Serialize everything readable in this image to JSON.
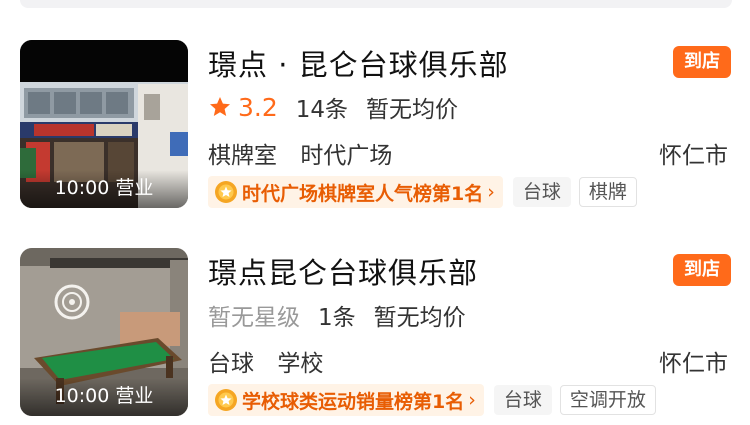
{
  "colors": {
    "accent": "#ff6a1a",
    "rank_bg": "#fff3e6",
    "rank_text": "#e85d04"
  },
  "listings": [
    {
      "title": "璟点 · 昆仑台球俱乐部",
      "store_badge": "到店",
      "hours": "10:00 营业",
      "rating": "3.2",
      "reviews": "14条",
      "price": "暂无均价",
      "category": "棋牌室",
      "area": "时代广场",
      "city": "怀仁市",
      "rank_label": "时代广场棋牌室人气榜第1名",
      "tags": [
        "台球",
        "棋牌"
      ],
      "image": "storefront photo",
      "icons": {
        "rating": "star-icon",
        "rank": "medal-icon"
      }
    },
    {
      "title": "璟点昆仑台球俱乐部",
      "store_badge": "到店",
      "hours": "10:00 营业",
      "star_level": "暂无星级",
      "reviews": "1条",
      "price": "暂无均价",
      "category": "台球",
      "area": "学校",
      "city": "怀仁市",
      "rank_label": "学校球类运动销量榜第1名",
      "tags": [
        "台球",
        "空调开放"
      ],
      "image": "billiard table photo",
      "icons": {
        "rank": "medal-icon"
      }
    }
  ]
}
